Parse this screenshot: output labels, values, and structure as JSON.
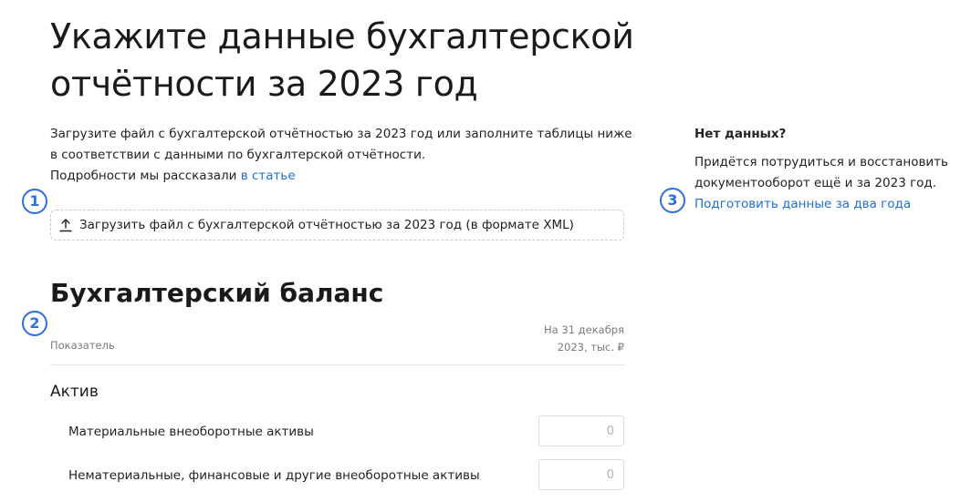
{
  "page": {
    "title": "Укажите данные бухгалтерской отчётности за 2023 год"
  },
  "intro": {
    "line1": "Загрузите файл с бухгалтерской отчётностью за 2023 год или заполните таблицы ниже",
    "line2": "в соответствии с данными по бухгалтерской отчётности.",
    "details_prefix": "Подробности мы рассказали ",
    "details_link": "в статье"
  },
  "markers": {
    "m1": "1",
    "m2": "2",
    "m3": "3"
  },
  "upload": {
    "icon": "upload-icon",
    "label": "Загрузить файл с бухгалтерской отчётностью за 2023 год (в формате XML)"
  },
  "side": {
    "title": "Нет данных?",
    "text": "Придётся потрудиться и восстановить документооборот ещё и за 2023 год.",
    "link": "Подготовить данные за два года"
  },
  "balance": {
    "title": "Бухгалтерский баланс",
    "column_label": "Показатель",
    "column_date_line1": "На 31 декабря",
    "column_date_line2": "2023, тыс. ₽",
    "group": "Актив",
    "rows": [
      {
        "label": "Материальные внеоборотные активы",
        "placeholder": "0"
      },
      {
        "label": "Нематериальные, финансовые и другие внеоборотные активы",
        "placeholder": "0"
      }
    ]
  },
  "colors": {
    "accent": "#2f6fd9",
    "link": "#1f6fd6"
  }
}
